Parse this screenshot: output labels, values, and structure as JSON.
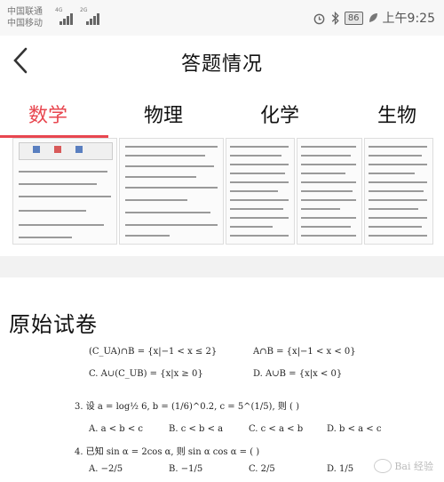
{
  "status_bar": {
    "carrier_1": "中国联通",
    "carrier_2": "中国移动",
    "net_1": "4G",
    "net_2": "2G",
    "battery": "86",
    "time": "上午9:25"
  },
  "header": {
    "title": "答题情况"
  },
  "tabs": [
    {
      "label": "数学",
      "active": true
    },
    {
      "label": "物理",
      "active": false
    },
    {
      "label": "化学",
      "active": false
    },
    {
      "label": "生物",
      "active": false
    }
  ],
  "section": {
    "title": "原始试卷"
  },
  "paper": {
    "line_partial_a": "(C_UA)∩B = {x|−1 < x ≤ 2}",
    "line_partial_b": "A∩B = {x|−1 < x < 0}",
    "opt_1c": "C.   A∪(C_UB) = {x|x ≥ 0}",
    "opt_1d": "D.   A∪B = {x|x < 0}",
    "q3": "3. 设 a = log½ 6,   b = (1/6)^0.2,   c = 5^(1/5),  则 (       )",
    "q3_a": "A.   a < b < c",
    "q3_b": "B.   c < b < a",
    "q3_c": "C.   c < a < b",
    "q3_d": "D.   b < a < c",
    "q4": "4. 已知 sin α = 2cos α, 则 sin α cos α = (       )",
    "q4_a": "A.  −2/5",
    "q4_b": "B.  −1/5",
    "q4_c": "C.  2/5",
    "q4_d": "D.  1/5"
  },
  "watermark": "Bai 经验"
}
